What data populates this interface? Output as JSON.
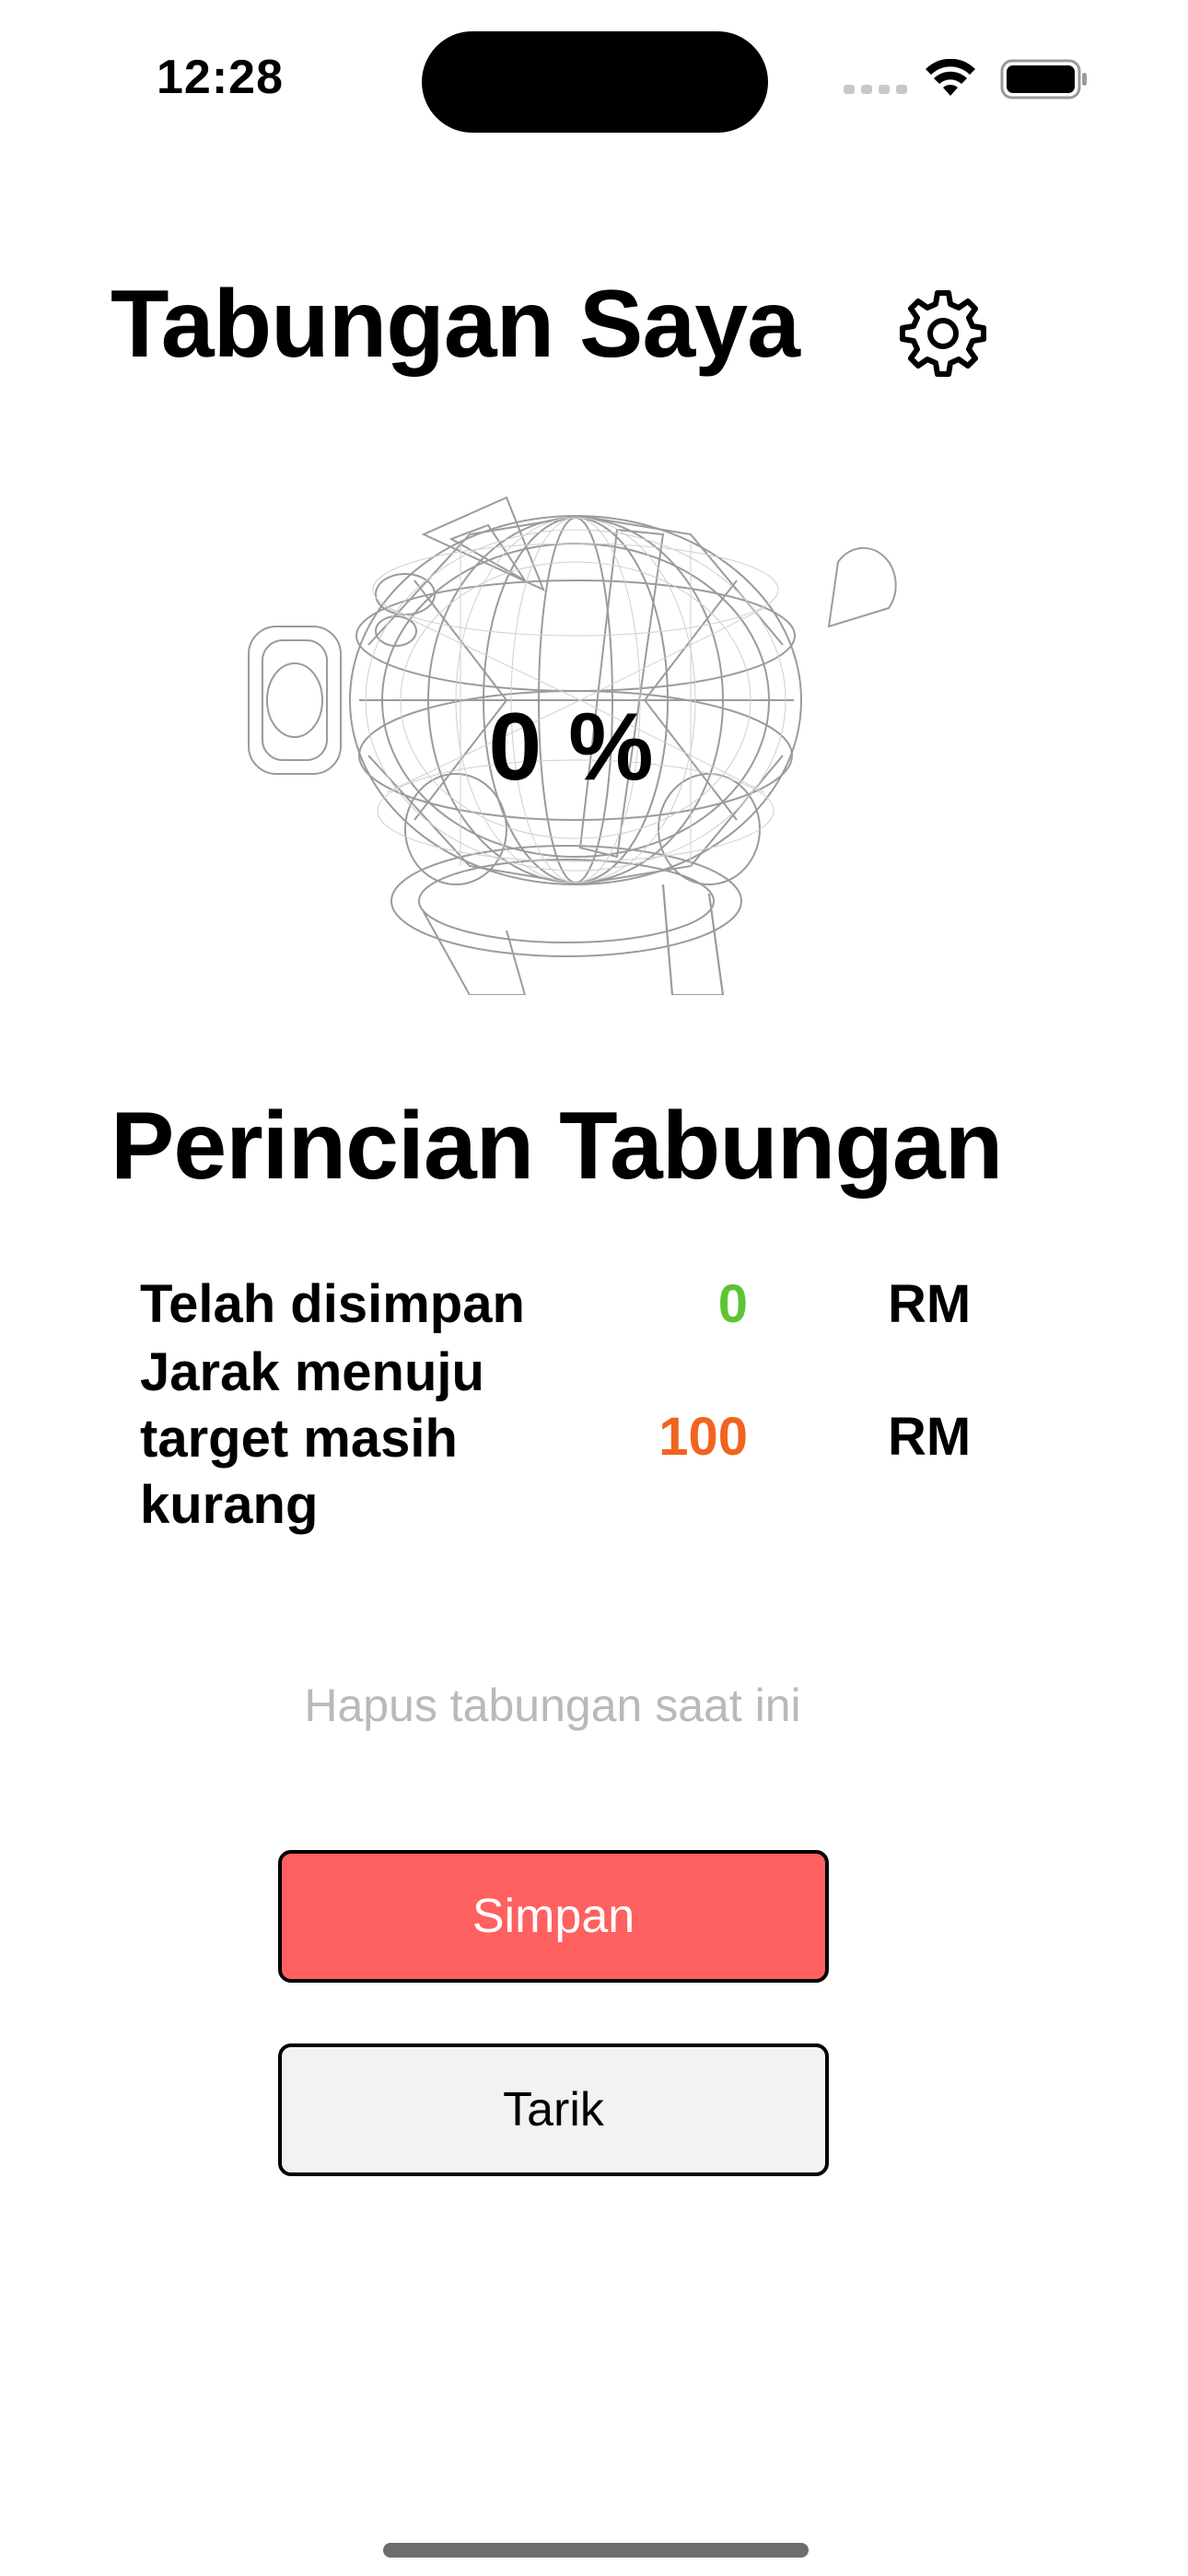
{
  "status_bar": {
    "time": "12:28",
    "icons": [
      "signal-icon",
      "wifi-icon",
      "battery-icon"
    ]
  },
  "header": {
    "title": "Tabungan Saya",
    "settings_icon": "gear-icon"
  },
  "piggy": {
    "percent_label": "0 %",
    "progress_percent": 0,
    "image": "piggy-bank-wireframe"
  },
  "details": {
    "heading": "Perincian Tabungan",
    "saved": {
      "label": "Telah disimpan",
      "value": "0",
      "currency": "RM",
      "color": "#5cc434"
    },
    "remaining": {
      "label": "Jarak menuju target masih kurang",
      "value": "100",
      "currency": "RM",
      "color": "#f0641e"
    }
  },
  "actions": {
    "reset_label": "Hapus tabungan saat ini",
    "save_label": "Simpan",
    "save_color": "#ff6060",
    "withdraw_label": "Tarik",
    "withdraw_color": "#f2f2f2"
  }
}
